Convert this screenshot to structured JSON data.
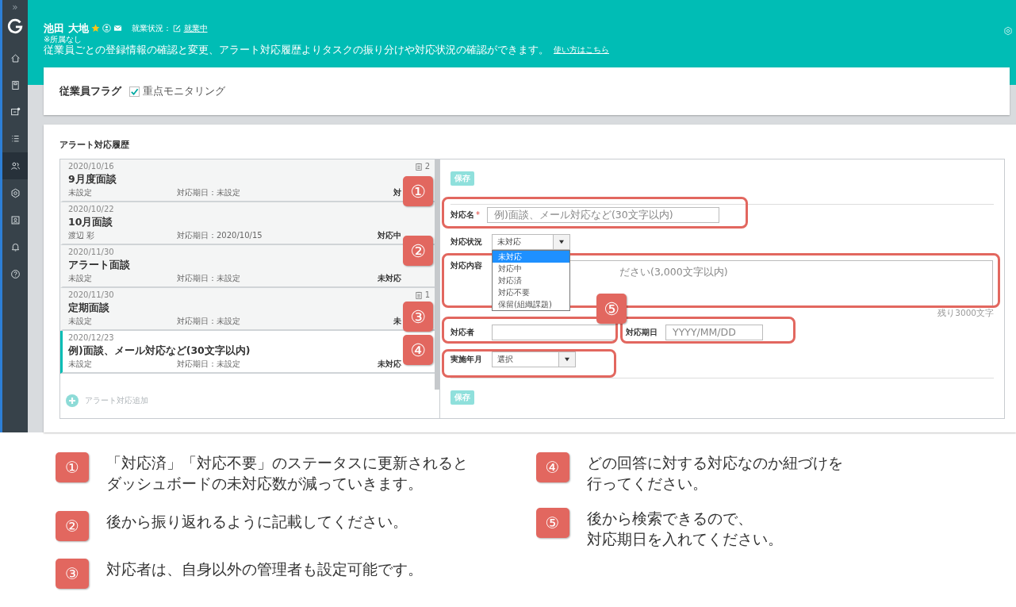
{
  "sidebar": {
    "expand": "»",
    "items": [
      {
        "kind": "home",
        "selected": false
      },
      {
        "kind": "book",
        "selected": false
      },
      {
        "kind": "chat",
        "selected": false
      },
      {
        "kind": "list",
        "selected": false
      },
      {
        "kind": "people",
        "selected": true
      },
      {
        "kind": "gear",
        "selected": false
      },
      {
        "kind": "card",
        "selected": false
      },
      {
        "kind": "bell",
        "selected": false
      },
      {
        "kind": "help",
        "selected": false
      }
    ]
  },
  "header": {
    "name": "池田 大地",
    "work_status_label": "就業状況：",
    "work_status": "就業中",
    "affiliation": "※所属なし",
    "description": "従業員ごとの登録情報の確認と変更、アラート対応履歴よりタスクの振り分けや対応状況の確認ができます。",
    "help_link": "使い方はこちら"
  },
  "flags": {
    "label": "従業員フラグ",
    "items": [
      {
        "label": "重点モニタリング",
        "checked": true
      }
    ]
  },
  "history": {
    "title": "アラート対応履歴",
    "items": [
      {
        "date": "2020/10/16",
        "count": "2",
        "title": "9月度面談",
        "assignee": "未設定",
        "due": "対応期日：未設定",
        "status": "対",
        "selected": false
      },
      {
        "date": "2020/10/22",
        "title": "10月面談",
        "assignee": "渡辺 彩",
        "due": "対応期日：2020/10/15",
        "status": "対応中",
        "selected": false
      },
      {
        "date": "2020/11/30",
        "title": "アラート面談",
        "assignee": "未設定",
        "due": "対応期日：未設定",
        "status": "未対応",
        "selected": false
      },
      {
        "date": "2020/11/30",
        "count": "1",
        "title": "定期面談",
        "assignee": "未設定",
        "due": "対応期日：未設定",
        "status": "未",
        "selected": false
      },
      {
        "date": "2020/12/23",
        "title": "例)面談、メール対応など(30文字以内)",
        "assignee": "未設定",
        "due": "対応期日：未設定",
        "status": "未対応",
        "selected": true
      }
    ],
    "add_label": "アラート対応追加"
  },
  "form": {
    "save_top": "保存",
    "name_label": "対応名",
    "required_mark": "*",
    "name_placeholder": "例)面談、メール対応など(30文字以内)",
    "status_label": "対応状況",
    "status_value": "未対応",
    "status_options": [
      {
        "label": "未対応",
        "selected": true
      },
      {
        "label": "対応中",
        "selected": false
      },
      {
        "label": "対応済",
        "selected": false
      },
      {
        "label": "対応不要",
        "selected": false
      },
      {
        "label": "保留(組織課題)",
        "selected": false
      }
    ],
    "content_label": "対応内容",
    "content_placeholder": "ださい(3,000文字以内)",
    "remaining": "残り3000文字",
    "assignee_label": "対応者",
    "due_label": "対応期日",
    "due_placeholder": "YYYY/MM/DD",
    "month_label": "実施年月",
    "month_value": "選択",
    "save_bottom": "保存"
  },
  "callouts": [
    "①",
    "②",
    "③",
    "⑤",
    "④"
  ],
  "notes": [
    {
      "number": "①",
      "lines": [
        "「対応済」「対応不要」のステータスに更新されると",
        "ダッシュボードの未対応数が減っていきます。"
      ]
    },
    {
      "number": "②",
      "lines": [
        "後から振り返れるように記載してください。"
      ]
    },
    {
      "number": "③",
      "lines": [
        "対応者は、自身以外の管理者も設定可能です。"
      ]
    },
    {
      "number": "④",
      "lines": [
        "どの回答に対する対応なのか紐づけを",
        "行ってください。"
      ]
    },
    {
      "number": "⑤",
      "lines": [
        "後から検索できるので、",
        "対応期日を入れてください。"
      ]
    }
  ]
}
